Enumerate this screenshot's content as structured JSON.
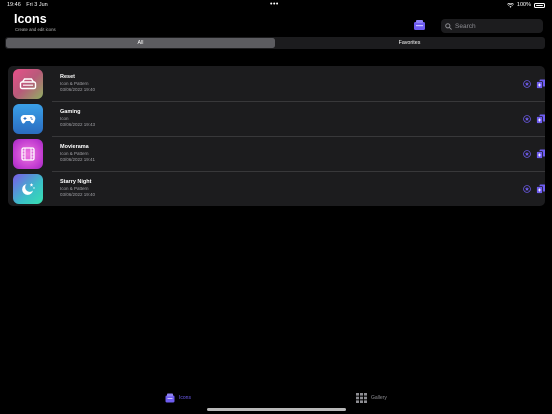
{
  "status_bar": {
    "time": "19:46",
    "date": "Fri 3 Jun",
    "battery": "100%"
  },
  "header": {
    "title": "Icons",
    "subtitle": "Create and edit icons",
    "search_placeholder": "Search"
  },
  "segments": [
    {
      "label": "All",
      "active": true
    },
    {
      "label": "Favorites",
      "active": false
    }
  ],
  "items": [
    {
      "name": "Reset",
      "type": "Icon & Pattern",
      "date": "03/06/2022 19:40",
      "icon": "drive-icon"
    },
    {
      "name": "Gaming",
      "type": "Icon",
      "date": "03/06/2022 19:43",
      "icon": "gamecontroller-icon"
    },
    {
      "name": "Movierama",
      "type": "Icon & Pattern",
      "date": "03/06/2022 19:41",
      "icon": "film-icon"
    },
    {
      "name": "Starry Night",
      "type": "Icon & Pattern",
      "date": "03/06/2022 19:40",
      "icon": "moon-stars-icon"
    }
  ],
  "tabbar": {
    "icons_label": "Icons",
    "gallery_label": "Gallery"
  },
  "colors": {
    "accent": "#6e5cf0",
    "background": "#000000",
    "card": "#1c1c1e"
  }
}
